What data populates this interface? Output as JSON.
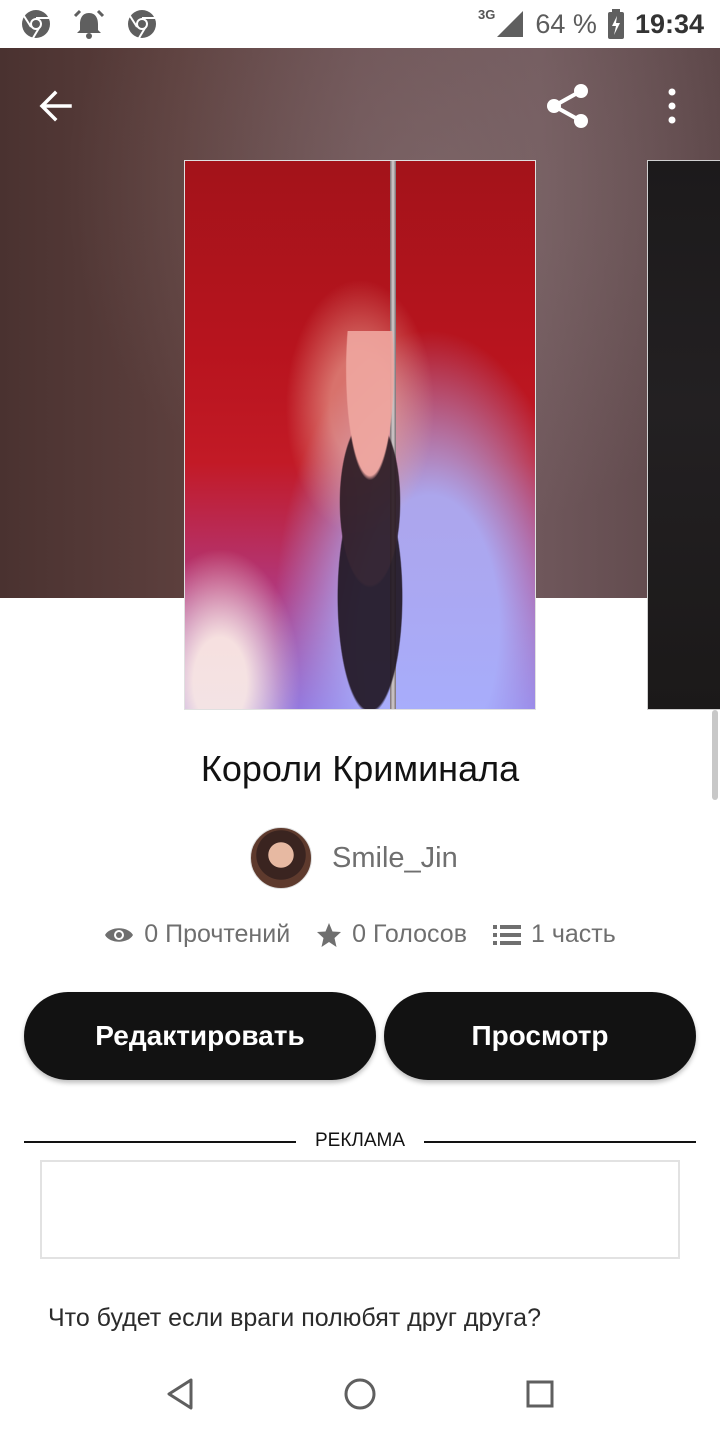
{
  "status_bar": {
    "network": "3G",
    "battery": "64 %",
    "time": "19:34",
    "icons": [
      "chrome-icon",
      "alarm-icon",
      "chrome-icon"
    ]
  },
  "toolbar": {
    "back_icon": "arrow-left-icon",
    "share_icon": "share-icon",
    "more_icon": "more-vertical-icon"
  },
  "story": {
    "title": "Короли Криминала",
    "author": "Smile_Jin",
    "stats": {
      "reads": "0 Прочтений",
      "votes": "0 Голосов",
      "parts": "1 часть"
    },
    "description": "Что будет если враги полюбят друг друга?"
  },
  "actions": {
    "edit_label": "Редактировать",
    "view_label": "Просмотр"
  },
  "ad": {
    "label": "РЕКЛАМА"
  },
  "colors": {
    "button_bg": "#121212",
    "hero_bg": "#5c3f3d"
  }
}
